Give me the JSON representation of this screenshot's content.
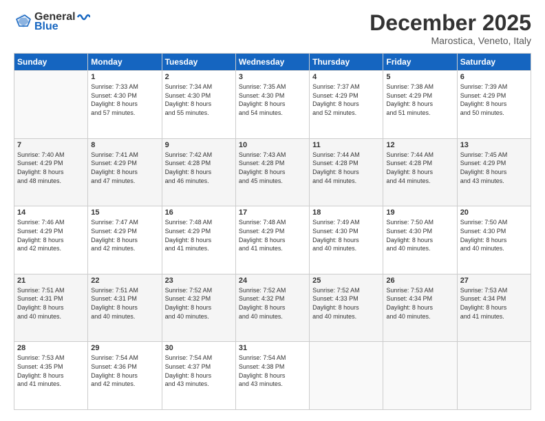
{
  "header": {
    "logo_general": "General",
    "logo_blue": "Blue",
    "month": "December 2025",
    "location": "Marostica, Veneto, Italy"
  },
  "days_header": [
    "Sunday",
    "Monday",
    "Tuesday",
    "Wednesday",
    "Thursday",
    "Friday",
    "Saturday"
  ],
  "weeks": [
    [
      {
        "num": "",
        "info": ""
      },
      {
        "num": "1",
        "info": "Sunrise: 7:33 AM\nSunset: 4:30 PM\nDaylight: 8 hours\nand 57 minutes."
      },
      {
        "num": "2",
        "info": "Sunrise: 7:34 AM\nSunset: 4:30 PM\nDaylight: 8 hours\nand 55 minutes."
      },
      {
        "num": "3",
        "info": "Sunrise: 7:35 AM\nSunset: 4:30 PM\nDaylight: 8 hours\nand 54 minutes."
      },
      {
        "num": "4",
        "info": "Sunrise: 7:37 AM\nSunset: 4:29 PM\nDaylight: 8 hours\nand 52 minutes."
      },
      {
        "num": "5",
        "info": "Sunrise: 7:38 AM\nSunset: 4:29 PM\nDaylight: 8 hours\nand 51 minutes."
      },
      {
        "num": "6",
        "info": "Sunrise: 7:39 AM\nSunset: 4:29 PM\nDaylight: 8 hours\nand 50 minutes."
      }
    ],
    [
      {
        "num": "7",
        "info": "Sunrise: 7:40 AM\nSunset: 4:29 PM\nDaylight: 8 hours\nand 48 minutes."
      },
      {
        "num": "8",
        "info": "Sunrise: 7:41 AM\nSunset: 4:29 PM\nDaylight: 8 hours\nand 47 minutes."
      },
      {
        "num": "9",
        "info": "Sunrise: 7:42 AM\nSunset: 4:28 PM\nDaylight: 8 hours\nand 46 minutes."
      },
      {
        "num": "10",
        "info": "Sunrise: 7:43 AM\nSunset: 4:28 PM\nDaylight: 8 hours\nand 45 minutes."
      },
      {
        "num": "11",
        "info": "Sunrise: 7:44 AM\nSunset: 4:28 PM\nDaylight: 8 hours\nand 44 minutes."
      },
      {
        "num": "12",
        "info": "Sunrise: 7:44 AM\nSunset: 4:28 PM\nDaylight: 8 hours\nand 44 minutes."
      },
      {
        "num": "13",
        "info": "Sunrise: 7:45 AM\nSunset: 4:29 PM\nDaylight: 8 hours\nand 43 minutes."
      }
    ],
    [
      {
        "num": "14",
        "info": "Sunrise: 7:46 AM\nSunset: 4:29 PM\nDaylight: 8 hours\nand 42 minutes."
      },
      {
        "num": "15",
        "info": "Sunrise: 7:47 AM\nSunset: 4:29 PM\nDaylight: 8 hours\nand 42 minutes."
      },
      {
        "num": "16",
        "info": "Sunrise: 7:48 AM\nSunset: 4:29 PM\nDaylight: 8 hours\nand 41 minutes."
      },
      {
        "num": "17",
        "info": "Sunrise: 7:48 AM\nSunset: 4:29 PM\nDaylight: 8 hours\nand 41 minutes."
      },
      {
        "num": "18",
        "info": "Sunrise: 7:49 AM\nSunset: 4:30 PM\nDaylight: 8 hours\nand 40 minutes."
      },
      {
        "num": "19",
        "info": "Sunrise: 7:50 AM\nSunset: 4:30 PM\nDaylight: 8 hours\nand 40 minutes."
      },
      {
        "num": "20",
        "info": "Sunrise: 7:50 AM\nSunset: 4:30 PM\nDaylight: 8 hours\nand 40 minutes."
      }
    ],
    [
      {
        "num": "21",
        "info": "Sunrise: 7:51 AM\nSunset: 4:31 PM\nDaylight: 8 hours\nand 40 minutes."
      },
      {
        "num": "22",
        "info": "Sunrise: 7:51 AM\nSunset: 4:31 PM\nDaylight: 8 hours\nand 40 minutes."
      },
      {
        "num": "23",
        "info": "Sunrise: 7:52 AM\nSunset: 4:32 PM\nDaylight: 8 hours\nand 40 minutes."
      },
      {
        "num": "24",
        "info": "Sunrise: 7:52 AM\nSunset: 4:32 PM\nDaylight: 8 hours\nand 40 minutes."
      },
      {
        "num": "25",
        "info": "Sunrise: 7:52 AM\nSunset: 4:33 PM\nDaylight: 8 hours\nand 40 minutes."
      },
      {
        "num": "26",
        "info": "Sunrise: 7:53 AM\nSunset: 4:34 PM\nDaylight: 8 hours\nand 40 minutes."
      },
      {
        "num": "27",
        "info": "Sunrise: 7:53 AM\nSunset: 4:34 PM\nDaylight: 8 hours\nand 41 minutes."
      }
    ],
    [
      {
        "num": "28",
        "info": "Sunrise: 7:53 AM\nSunset: 4:35 PM\nDaylight: 8 hours\nand 41 minutes."
      },
      {
        "num": "29",
        "info": "Sunrise: 7:54 AM\nSunset: 4:36 PM\nDaylight: 8 hours\nand 42 minutes."
      },
      {
        "num": "30",
        "info": "Sunrise: 7:54 AM\nSunset: 4:37 PM\nDaylight: 8 hours\nand 43 minutes."
      },
      {
        "num": "31",
        "info": "Sunrise: 7:54 AM\nSunset: 4:38 PM\nDaylight: 8 hours\nand 43 minutes."
      },
      {
        "num": "",
        "info": ""
      },
      {
        "num": "",
        "info": ""
      },
      {
        "num": "",
        "info": ""
      }
    ]
  ]
}
